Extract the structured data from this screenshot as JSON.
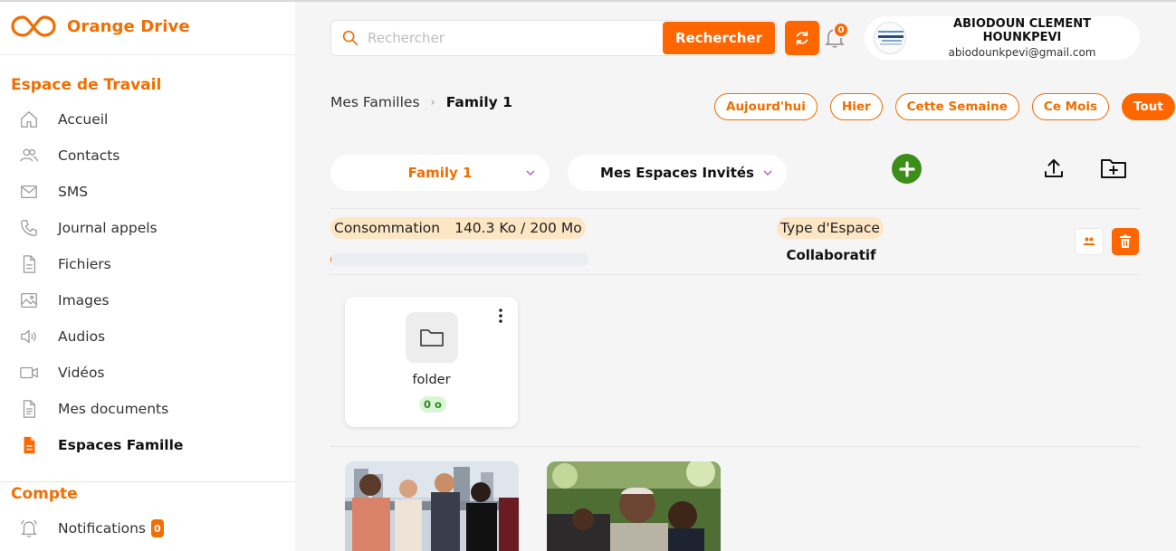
{
  "app": {
    "title": "Orange Drive",
    "brand_color": "#f16e00"
  },
  "sidebar": {
    "workspace_title": "Espace de Travail",
    "items": [
      {
        "label": "Accueil",
        "icon": "home-icon"
      },
      {
        "label": "Contacts",
        "icon": "contacts-icon"
      },
      {
        "label": "SMS",
        "icon": "mail-icon"
      },
      {
        "label": "Journal appels",
        "icon": "phone-icon"
      },
      {
        "label": "Fichiers",
        "icon": "file-icon"
      },
      {
        "label": "Images",
        "icon": "image-icon"
      },
      {
        "label": "Audios",
        "icon": "speaker-icon"
      },
      {
        "label": "Vidéos",
        "icon": "video-icon"
      },
      {
        "label": "Mes documents",
        "icon": "document-icon"
      },
      {
        "label": "Espaces Famille",
        "icon": "family-space-icon",
        "active": true
      }
    ],
    "account_title": "Compte",
    "account_items": [
      {
        "label": "Notifications",
        "icon": "bell-icon",
        "badge": "0"
      }
    ]
  },
  "header": {
    "search_placeholder": "Rechercher",
    "search_button": "Rechercher",
    "notification_count": "0",
    "user": {
      "name": "ABIODOUN CLEMENT HOUNKPEVI",
      "email": "abiodounkpevi@gmail.com"
    }
  },
  "breadcrumb": {
    "parent": "Mes Familles",
    "current": "Family 1"
  },
  "filters": [
    {
      "label": "Aujourd'hui"
    },
    {
      "label": "Hier"
    },
    {
      "label": "Cette Semaine"
    },
    {
      "label": "Ce Mois"
    },
    {
      "label": "Tout",
      "active": true
    }
  ],
  "selectors": {
    "family": "Family 1",
    "invited": "Mes Espaces Invités"
  },
  "consumption": {
    "label": "Consommation",
    "value": "140.3 Ko / 200 Mo",
    "fraction": 0.0007
  },
  "space_type": {
    "label": "Type d'Espace",
    "value": "Collaboratif"
  },
  "folders": [
    {
      "name": "folder",
      "size": "0 o"
    }
  ]
}
